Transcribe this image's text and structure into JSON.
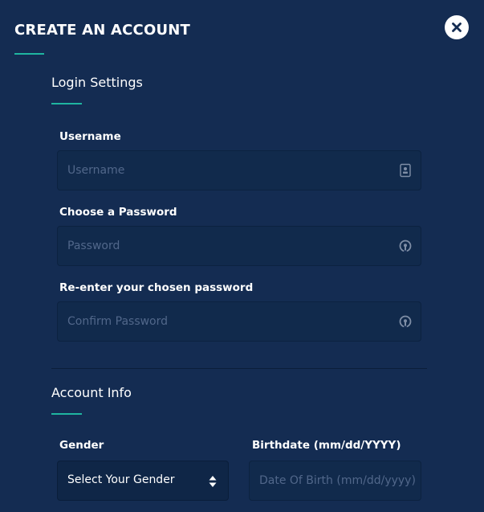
{
  "modal": {
    "title": "CREATE AN ACCOUNT",
    "close_icon": "close-icon"
  },
  "login_settings": {
    "heading": "Login Settings",
    "username": {
      "label": "Username",
      "placeholder": "Username",
      "icon": "id-card-icon"
    },
    "password": {
      "label": "Choose a Password",
      "placeholder": "Password",
      "icon": "lock-icon"
    },
    "confirm_password": {
      "label": "Re-enter your chosen password",
      "placeholder": "Confirm Password",
      "icon": "lock-icon"
    }
  },
  "account_info": {
    "heading": "Account Info",
    "gender": {
      "label": "Gender",
      "selected": "Select Your Gender",
      "icon": "sort-arrows-icon"
    },
    "birthdate": {
      "label": "Birthdate (mm/dd/YYYY)",
      "placeholder": "Date Of Birth (mm/dd/yyyy)"
    }
  },
  "colors": {
    "background": "#142c52",
    "input_background": "#112a4c",
    "accent": "#1fb5a0",
    "placeholder": "#51678a",
    "text": "#ffffff"
  }
}
